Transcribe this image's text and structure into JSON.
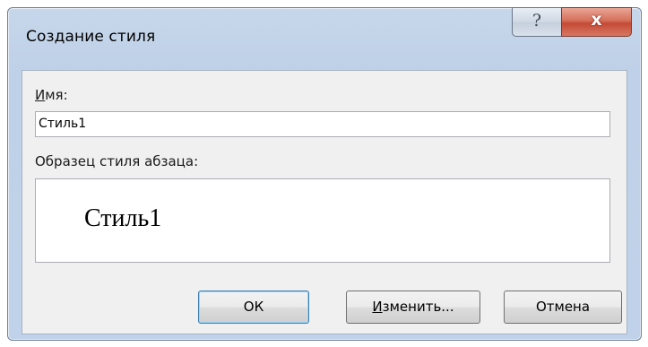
{
  "window": {
    "title": "Создание стиля",
    "help_button": "?",
    "close_button": "x"
  },
  "form": {
    "name_label_accel": "И",
    "name_label_rest": "мя:",
    "name_value": "Стиль1",
    "preview_label": "Образец стиля абзаца:",
    "preview_text": "Стиль1"
  },
  "buttons": {
    "ok": "ОК",
    "change_accel": "И",
    "change_rest": "зменить...",
    "cancel": "Отмена"
  }
}
